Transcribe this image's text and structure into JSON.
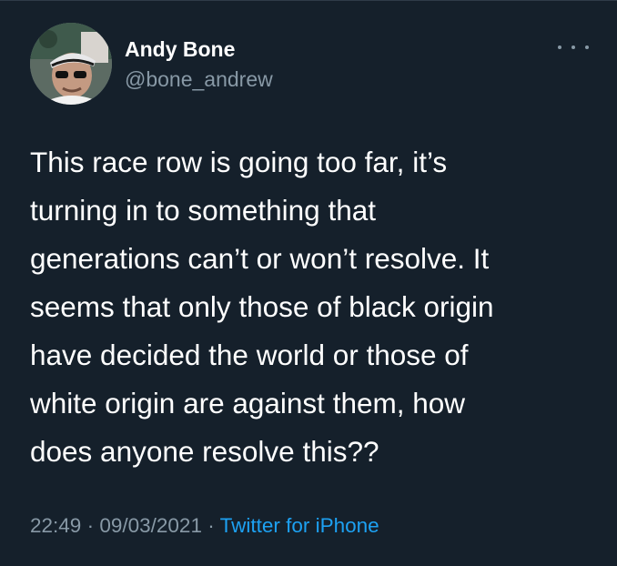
{
  "author": {
    "name": "Andy Bone",
    "handle": "@bone_andrew"
  },
  "tweet": {
    "lines": [
      "This race row is going too far, it’s",
      "turning in to something that",
      "generations can’t or won’t resolve.  It",
      "seems that only those of black origin",
      "have decided the world or those of",
      "white origin are against them, how",
      "does anyone resolve this??"
    ],
    "time": "22:49",
    "separator": "·",
    "date": "09/03/2021",
    "source": "Twitter for iPhone"
  },
  "icons": {
    "more": "more-options-icon",
    "avatar": "profile-photo"
  },
  "colors": {
    "background": "#15202b",
    "primary_text": "#ffffff",
    "secondary_text": "#8899a6",
    "link": "#1da1f2"
  }
}
